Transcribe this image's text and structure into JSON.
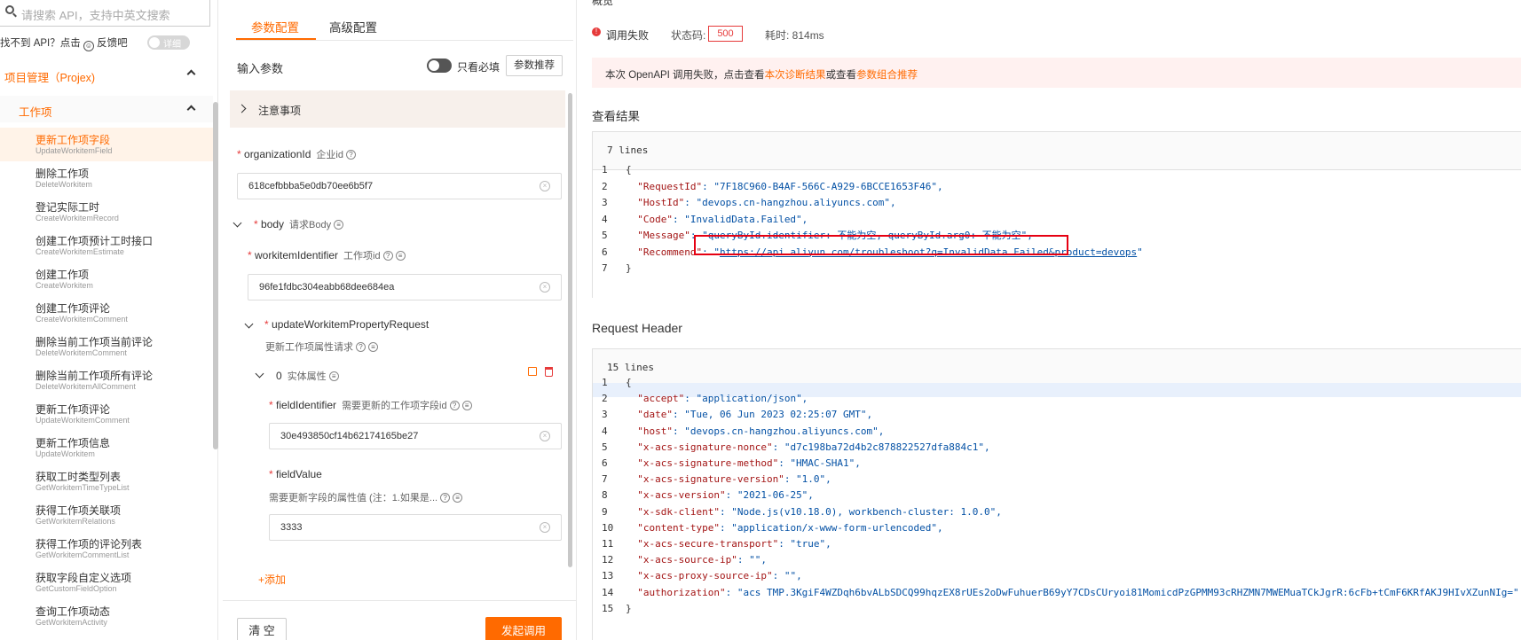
{
  "sidebar": {
    "search_placeholder": "请搜索 API，支持中英文搜索",
    "feedback_prefix": "找不到 API？点击",
    "feedback_label": "反馈吧",
    "detail_toggle": "详细",
    "group_title": "项目管理（Projex)",
    "subgroup_title": "工作项",
    "items": [
      {
        "cn": "更新工作项字段",
        "en": "UpdateWorkitemField"
      },
      {
        "cn": "删除工作项",
        "en": "DeleteWorkitem"
      },
      {
        "cn": "登记实际工时",
        "en": "CreateWorkitemRecord"
      },
      {
        "cn": "创建工作项预计工时接口",
        "en": "CreateWorkitemEstimate"
      },
      {
        "cn": "创建工作项",
        "en": "CreateWorkitem"
      },
      {
        "cn": "创建工作项评论",
        "en": "CreateWorkitemComment"
      },
      {
        "cn": "删除当前工作项当前评论",
        "en": "DeleteWorkitemComment"
      },
      {
        "cn": "删除当前工作项所有评论",
        "en": "DeleteWorkitemAllComment"
      },
      {
        "cn": "更新工作项评论",
        "en": "UpdateWorkitemComment"
      },
      {
        "cn": "更新工作项信息",
        "en": "UpdateWorkitem"
      },
      {
        "cn": "获取工时类型列表",
        "en": "GetWorkitemTimeTypeList"
      },
      {
        "cn": "获得工作项关联项",
        "en": "GetWorkitemRelations"
      },
      {
        "cn": "获得工作项的评论列表",
        "en": "GetWorkitemCommentList"
      },
      {
        "cn": "获取字段自定义选项",
        "en": "GetCustomFieldOption"
      },
      {
        "cn": "查询工作项动态",
        "en": "GetWorkitemActivity"
      }
    ]
  },
  "params": {
    "tabs": [
      "参数配置",
      "高级配置"
    ],
    "input_params_label": "输入参数",
    "required_only_label": "只看必填",
    "recommend_button": "参数推荐",
    "notes_label": "注意事项",
    "org_id_label": "organizationId",
    "org_id_sub": "企业id",
    "org_id_value": "618cefbbba5e0db70ee6b5f7",
    "body_label": "body",
    "body_sub": "请求Body",
    "workitem_id_label": "workitemIdentifier",
    "workitem_id_sub": "工作项id",
    "workitem_id_value": "96fe1fdbc304eabb68dee684ea",
    "update_req_label": "updateWorkitemPropertyRequest",
    "update_req_sub": "更新工作项属性请求",
    "entity_index": "0",
    "entity_label": "实体属性",
    "field_id_label": "fieldIdentifier",
    "field_id_sub": "需要更新的工作项字段id",
    "field_id_value": "30e493850cf14b62174165be27",
    "field_value_label": "fieldValue",
    "field_value_sub": "需要更新字段的属性值 (注：1.如果是...",
    "field_value_value": "3333",
    "add_label": "+添加",
    "clear_button": "清 空",
    "submit_button": "发起调用"
  },
  "result": {
    "overview": "概览",
    "status_label": "调用失败",
    "status_code_label": "状态码:",
    "status_code": "500",
    "elapsed_label": "耗时: 814ms",
    "alert_prefix": "本次 OpenAPI 调用失败，点击查看",
    "alert_link1": "本次诊断结果",
    "alert_mid": "或查看",
    "alert_link2": "参数组合推荐",
    "view_result_title": "查看结果",
    "result_lines_label": "7 lines",
    "result_lines": [
      {
        "n": "1",
        "k": "",
        "v": "{",
        "link": ""
      },
      {
        "n": "2",
        "k": "  \"RequestId\"",
        "v": ": \"7F18C960-B4AF-566C-A929-6BCCE1653F46\",",
        "link": ""
      },
      {
        "n": "3",
        "k": "  \"HostId\"",
        "v": ": \"devops.cn-hangzhou.aliyuncs.com\",",
        "link": ""
      },
      {
        "n": "4",
        "k": "  \"Code\"",
        "v": ": \"InvalidData.Failed\",",
        "link": ""
      },
      {
        "n": "5",
        "k": "  \"Message\"",
        "v": ": \"queryById.identifier: 不能为空, queryById.arg0: 不能为空\",",
        "link": ""
      },
      {
        "n": "6",
        "k": "  \"Recommend\"",
        "v": ": \"",
        "link": "https://api.aliyun.com/troubleshoot?q=InvalidData.Failed&product=devops"
      },
      {
        "n": "7",
        "k": "",
        "v": "}",
        "link": ""
      }
    ],
    "header_title": "Request Header",
    "header_lines_label": "15 lines",
    "header_lines": [
      {
        "n": "1",
        "k": "",
        "v": "{"
      },
      {
        "n": "2",
        "k": "  \"accept\"",
        "v": ": \"application/json\","
      },
      {
        "n": "3",
        "k": "  \"date\"",
        "v": ": \"Tue, 06 Jun 2023 02:25:07 GMT\","
      },
      {
        "n": "4",
        "k": "  \"host\"",
        "v": ": \"devops.cn-hangzhou.aliyuncs.com\","
      },
      {
        "n": "5",
        "k": "  \"x-acs-signature-nonce\"",
        "v": ": \"d7c198ba72d4b2c878822527dfa884c1\","
      },
      {
        "n": "6",
        "k": "  \"x-acs-signature-method\"",
        "v": ": \"HMAC-SHA1\","
      },
      {
        "n": "7",
        "k": "  \"x-acs-signature-version\"",
        "v": ": \"1.0\","
      },
      {
        "n": "8",
        "k": "  \"x-acs-version\"",
        "v": ": \"2021-06-25\","
      },
      {
        "n": "9",
        "k": "  \"x-sdk-client\"",
        "v": ": \"Node.js(v10.18.0), workbench-cluster: 1.0.0\","
      },
      {
        "n": "10",
        "k": "  \"content-type\"",
        "v": ": \"application/x-www-form-urlencoded\","
      },
      {
        "n": "11",
        "k": "  \"x-acs-secure-transport\"",
        "v": ": \"true\","
      },
      {
        "n": "12",
        "k": "  \"x-acs-source-ip\"",
        "v": ": \"\","
      },
      {
        "n": "13",
        "k": "  \"x-acs-proxy-source-ip\"",
        "v": ": \"\","
      },
      {
        "n": "14",
        "k": "  \"authorization\"",
        "v": ": \"acs TMP.3KgiF4WZDqh6bvALbSDCQ99hqzEX8rUEs2oDwFuhuerB69yY7CDsCUryoi81MomicdPzGPMM93cRHZMN7MWEMuaTCkJgrR:6cFb+tCmF6KRfAKJ9HIvXZunNIg=\""
      },
      {
        "n": "15",
        "k": "",
        "v": "}"
      }
    ]
  },
  "colors": {
    "accent": "#ff6a00",
    "error": "#e63a3a"
  }
}
